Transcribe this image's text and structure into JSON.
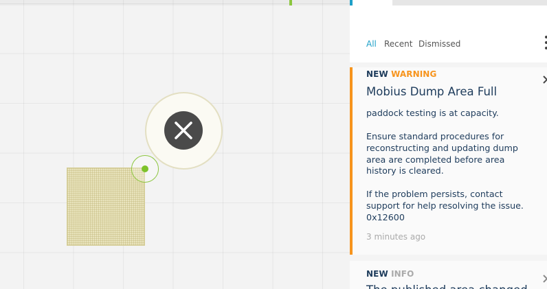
{
  "tabs": [
    {
      "label": "All",
      "active": true
    },
    {
      "label": "Recent",
      "active": false
    },
    {
      "label": "Dismissed",
      "active": false
    }
  ],
  "notifications": [
    {
      "new_label": "NEW",
      "severity": "WARNING",
      "title": "Mobius Dump Area Full",
      "body1": "paddock testing is at capacity.",
      "body2": "Ensure standard procedures for reconstructing and updating dump area are completed before area history is cleared.",
      "body3": "If the problem persists, contact support for help resolving the issue. 0x12600",
      "time": "3 minutes ago",
      "accent_color": "#f7941d"
    },
    {
      "new_label": "NEW",
      "severity": "INFO",
      "title_partial": "The published area changed"
    }
  ],
  "icons": {
    "map_close": "close-icon",
    "card_close": "close-icon",
    "menu": "kebab-menu-icon",
    "handle": "drag-handle-icon"
  },
  "colors": {
    "accent_blue": "#1ea0c8",
    "warning_orange": "#f7941d",
    "handle_green": "#8cc63f",
    "navy_text": "#1d3b5b"
  }
}
